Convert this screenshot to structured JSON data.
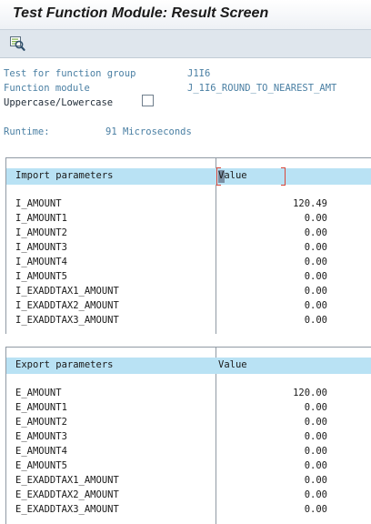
{
  "title": "Test Function Module: Result Screen",
  "toolbar": {
    "icon": "execute-icon"
  },
  "header": {
    "function_group_label": "Test for function group",
    "function_group_value": "J1I6",
    "function_module_label": "Function module",
    "function_module_value": "J_1I6_ROUND_TO_NEAREST_AMT",
    "uppercase_label": "Uppercase/Lowercase",
    "uppercase_checked": false,
    "runtime_label": "Runtime:",
    "runtime_value": "91 Microseconds"
  },
  "import_table": {
    "col_name": "Import parameters",
    "col_value": "Value",
    "rows": [
      {
        "name": "I_AMOUNT",
        "value": "120.49"
      },
      {
        "name": "I_AMOUNT1",
        "value": "0.00"
      },
      {
        "name": "I_AMOUNT2",
        "value": "0.00"
      },
      {
        "name": "I_AMOUNT3",
        "value": "0.00"
      },
      {
        "name": "I_AMOUNT4",
        "value": "0.00"
      },
      {
        "name": "I_AMOUNT5",
        "value": "0.00"
      },
      {
        "name": "I_EXADDTAX1_AMOUNT",
        "value": "0.00"
      },
      {
        "name": "I_EXADDTAX2_AMOUNT",
        "value": "0.00"
      },
      {
        "name": "I_EXADDTAX3_AMOUNT",
        "value": "0.00"
      }
    ]
  },
  "export_table": {
    "col_name": "Export parameters",
    "col_value": "Value",
    "rows": [
      {
        "name": "E_AMOUNT",
        "value": "120.00"
      },
      {
        "name": "E_AMOUNT1",
        "value": "0.00"
      },
      {
        "name": "E_AMOUNT2",
        "value": "0.00"
      },
      {
        "name": "E_AMOUNT3",
        "value": "0.00"
      },
      {
        "name": "E_AMOUNT4",
        "value": "0.00"
      },
      {
        "name": "E_AMOUNT5",
        "value": "0.00"
      },
      {
        "name": "E_EXADDTAX1_AMOUNT",
        "value": "0.00"
      },
      {
        "name": "E_EXADDTAX2_AMOUNT",
        "value": "0.00"
      },
      {
        "name": "E_EXADDTAX3_AMOUNT",
        "value": "0.00"
      }
    ]
  }
}
